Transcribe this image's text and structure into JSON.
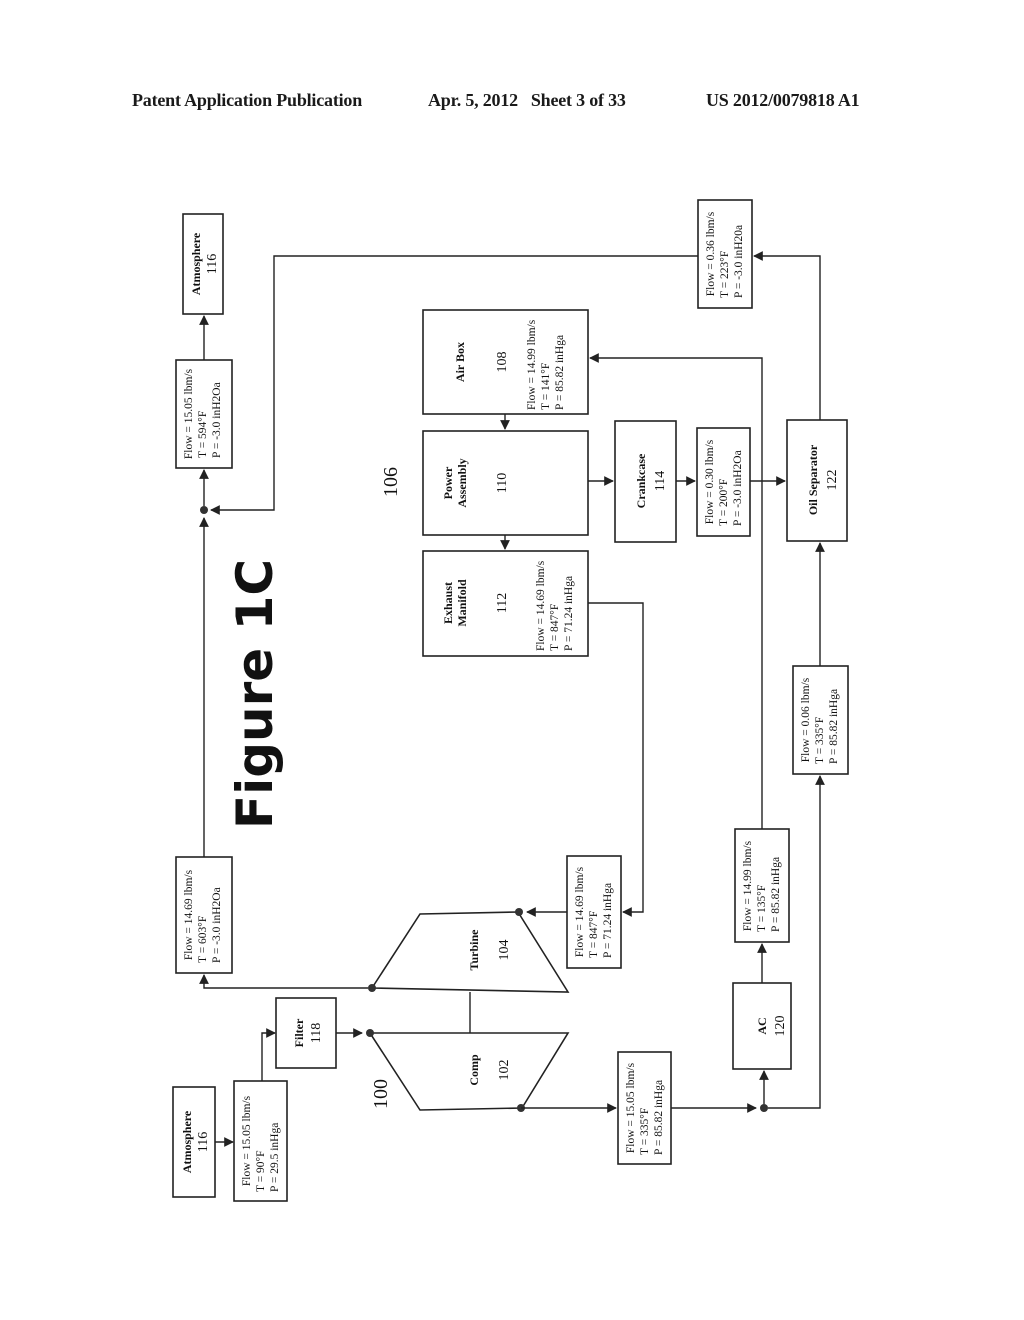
{
  "header": {
    "publication": "Patent Application Publication",
    "date_sheet": "Apr. 5, 2012   Sheet 3 of 33",
    "number": "US 2012/0079818 A1"
  },
  "figure": {
    "title": "Figure 1C",
    "refs": {
      "turbocharger": "100",
      "engine": "106"
    }
  },
  "components": {
    "atmosphere_in": {
      "label": "Atmosphere",
      "num": "116"
    },
    "atmosphere_out": {
      "label": "Atmosphere",
      "num": "116"
    },
    "filter": {
      "label": "Filter",
      "num": "118"
    },
    "compressor": {
      "label": "Comp",
      "num": "102"
    },
    "turbine": {
      "label": "Turbine",
      "num": "104"
    },
    "air_box": {
      "label": "Air Box",
      "num": "108"
    },
    "power_assembly": {
      "label1": "Power",
      "label2": "Assembly",
      "num": "110"
    },
    "exhaust_manifold": {
      "label1": "Exhaust",
      "label2": "Manifold",
      "num": "112"
    },
    "crankcase": {
      "label": "Crankcase",
      "num": "114"
    },
    "aftercooler": {
      "label": "AC",
      "num": "120"
    },
    "oil_separator": {
      "label": "Oil Separator",
      "num": "122"
    }
  },
  "flows": {
    "ambient_inlet": {
      "flow": "Flow = 15.05 lbm/s",
      "t": "T = 90°F",
      "p": "P = 29.5 inHga"
    },
    "turbine_outlet": {
      "flow": "Flow = 14.69 lbm/s",
      "t": "T = 603°F",
      "p": "P = -3.0 inH2Oa"
    },
    "stack_exhaust": {
      "flow": "Flow = 15.05 lbm/s",
      "t": "T = 594°F",
      "p": "P = -3.0 inH2Oa"
    },
    "turbine_inlet": {
      "flow": "Flow = 14.69 lbm/s",
      "t": "T = 847°F",
      "p": "P = 71.24 inHga"
    },
    "compressor_outlet": {
      "flow": "Flow = 15.05 lbm/s",
      "t": "T = 335°F",
      "p": "P = 85.82 inHga"
    },
    "ac_outlet": {
      "flow": "Flow = 14.99 lbm/s",
      "t": "T = 135°F",
      "p": "P = 85.82 inHga"
    },
    "bypass_to_separator": {
      "flow": "Flow = 0.06 lbm/s",
      "t": "T = 335°F",
      "p": "P = 85.82 inHga"
    },
    "crankcase_vent": {
      "flow": "Flow = 0.30 lbm/s",
      "t": "T = 200°F",
      "p": "P = -3.0 inH2Oa"
    },
    "separator_outlet": {
      "flow": "Flow = 0.36 lbm/s",
      "t": "T = 223°F",
      "p": "P = -3.0 inH20a"
    },
    "air_box_state": {
      "flow": "Flow = 14.99 lbm/s",
      "t": "T = 141°F",
      "p": "P = 85.82 inHga"
    },
    "exhaust_manifold_state": {
      "flow": "Flow = 14.69 lbm/s",
      "t": "T = 847°F",
      "p": "P = 71.24 inHga"
    }
  }
}
